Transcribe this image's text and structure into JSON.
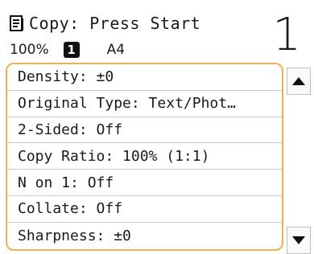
{
  "header": {
    "title": "Copy: Press Start",
    "copy_count": "1",
    "icon": "copy-document-icon"
  },
  "status": {
    "ratio": "100%",
    "copies": "1",
    "paper": "A4"
  },
  "settings_list": {
    "items": [
      {
        "label": "Density: ±0"
      },
      {
        "label": "Original Type: Text/Phot…"
      },
      {
        "label": "2-Sided: Off"
      },
      {
        "label": "Copy Ratio: 100% (1:1)"
      },
      {
        "label": "N on 1: Off"
      },
      {
        "label": "Collate: Off"
      },
      {
        "label": "Sharpness: ±0"
      }
    ],
    "highlight_color": "#f0b24a"
  },
  "scroll": {
    "up_icon": "arrow-up-icon",
    "down_icon": "arrow-down-icon"
  }
}
